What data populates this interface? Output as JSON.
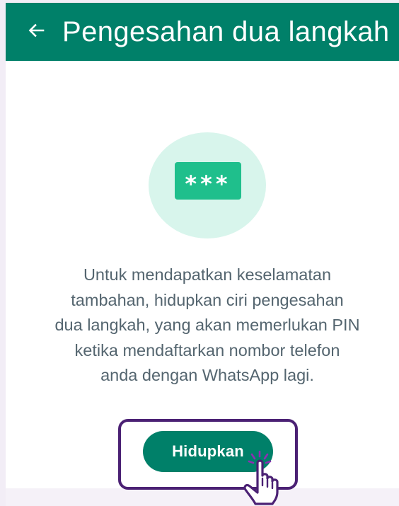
{
  "appbar": {
    "back_icon": "arrow-left-icon",
    "title": "Pengesahan dua langkah",
    "color": "#008069"
  },
  "illustration": {
    "icon": "password-card-icon",
    "pin_mask": "***",
    "circle_color": "#d8f5ec",
    "card_color": "#1fbf8c"
  },
  "description": {
    "lines": [
      "Untuk mendapatkan keselamatan",
      "tambahan, hidupkan ciri pengesahan",
      "dua langkah, yang akan memerlukan PIN",
      "ketika mendaftarkan nombor telefon",
      "anda dengan WhatsApp lagi."
    ]
  },
  "enable_button": {
    "label": "Hidupkan",
    "color": "#008069"
  },
  "overlay": {
    "cursor_icon": "hand-pointer-icon",
    "highlight_color": "#4b2174"
  }
}
